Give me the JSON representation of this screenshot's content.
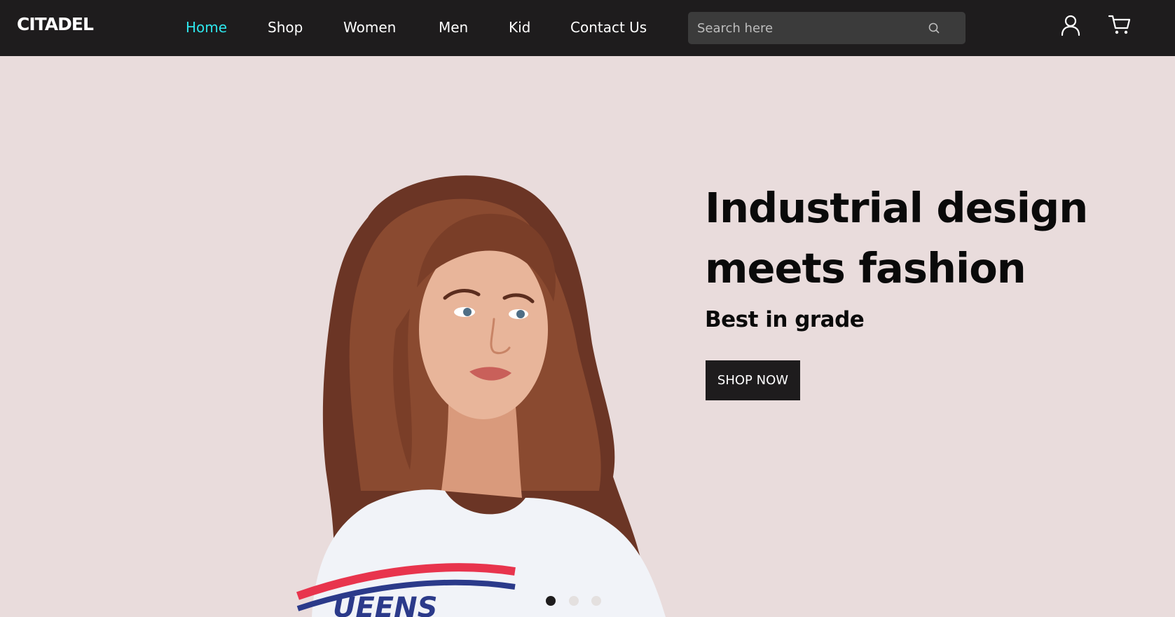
{
  "header": {
    "logo": "CITADEL",
    "nav": [
      {
        "label": "Home",
        "active": true
      },
      {
        "label": "Shop",
        "active": false
      },
      {
        "label": "Women",
        "active": false
      },
      {
        "label": "Men",
        "active": false
      },
      {
        "label": "Kid",
        "active": false
      },
      {
        "label": "Contact Us",
        "active": false
      }
    ],
    "search": {
      "placeholder": "Search here",
      "value": "",
      "icon": "search-icon"
    },
    "icons": [
      "user-icon",
      "cart-icon"
    ]
  },
  "hero": {
    "title_line1": "Industrial design",
    "title_line2": "meets fashion",
    "subtitle": "Best in grade",
    "cta": "SHOP NOW",
    "slides_total": 3,
    "active_slide": 1
  },
  "colors": {
    "navbar": "#1e1c1d",
    "active_link": "#2ee6ec",
    "hero_bg": "#e9dcdc",
    "button": "#1e1c1d"
  }
}
